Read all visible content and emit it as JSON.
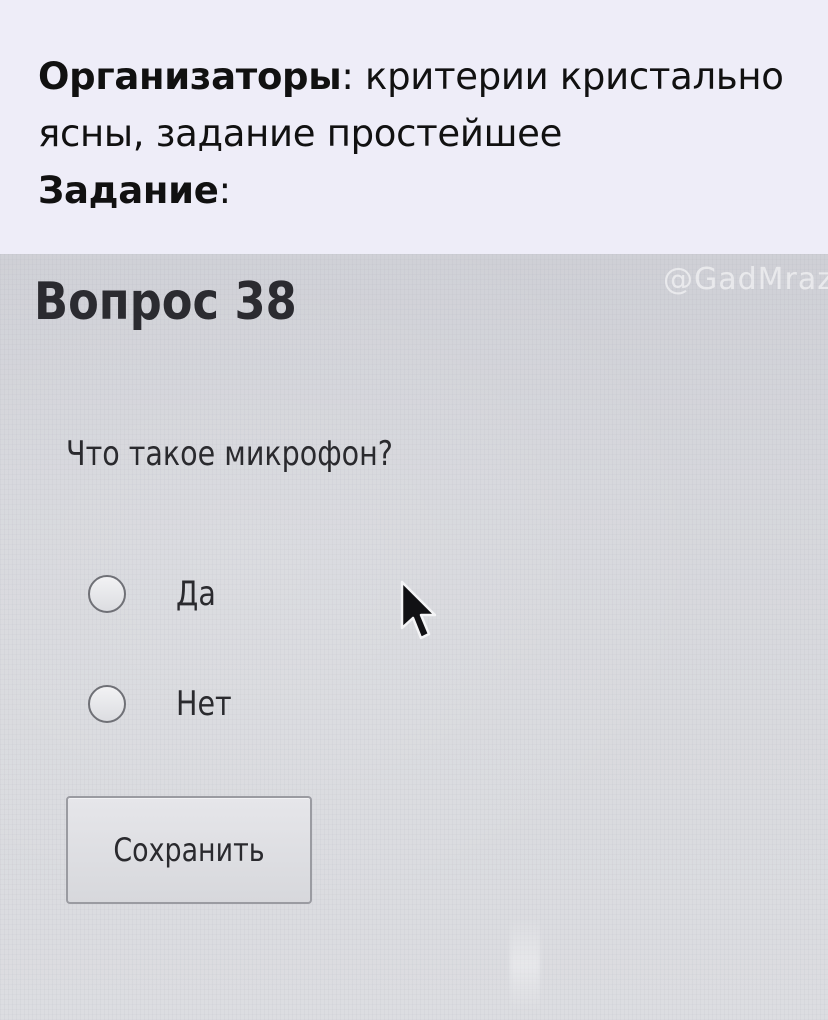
{
  "caption": {
    "line1_bold": "Организаторы",
    "line1_rest": ": критерии кристально",
    "line2": "ясны, задание простейшее",
    "line3_bold": "Задание",
    "line3_rest": ":"
  },
  "photo": {
    "watermark": "@GadMraz",
    "question_title": "Вопрос 38",
    "question_text": "Что такое микрофон?",
    "options": [
      {
        "label": "Да",
        "selected": false
      },
      {
        "label": "Нет",
        "selected": false
      }
    ],
    "save_label": "Сохранить",
    "icons": {
      "cursor": "mouse-pointer-arrow",
      "radio": "radio-button-empty"
    }
  }
}
